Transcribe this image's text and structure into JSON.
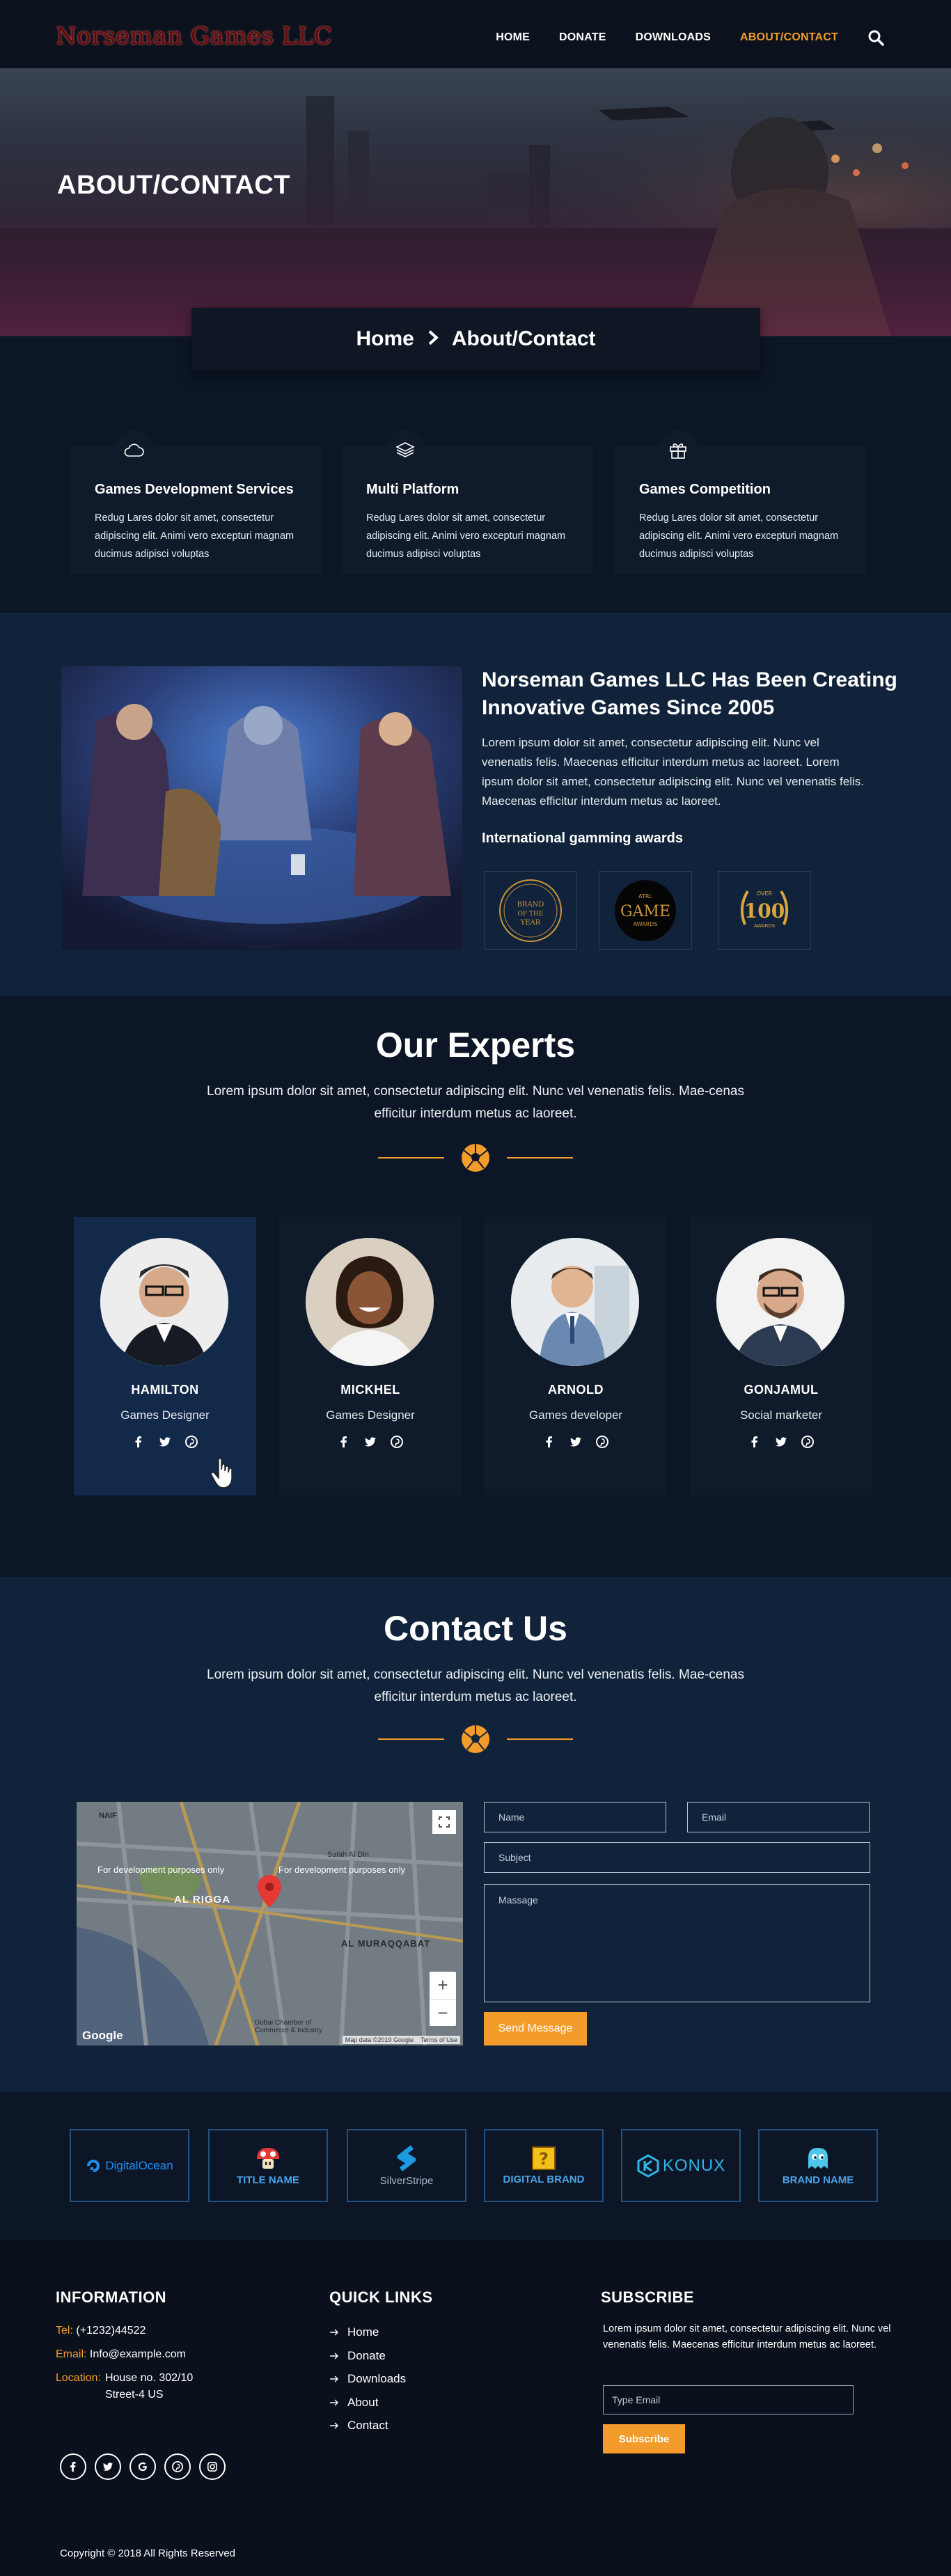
{
  "brand": {
    "logo_text": "Norseman Games LLC"
  },
  "nav": {
    "items": [
      "HOME",
      "DONATE",
      "DOWNLOADS",
      "ABOUT/CONTACT"
    ],
    "active_index": 3,
    "search_icon": "search-icon"
  },
  "hero": {
    "title": "ABOUT/CONTACT"
  },
  "breadcrumb": {
    "home": "Home",
    "current": "About/Contact"
  },
  "services": [
    {
      "icon": "cloud-icon",
      "title": "Games Development Services",
      "text": "Redug Lares dolor sit amet, consectetur adipiscing elit. Animi vero excepturi magnam ducimus adipisci voluptas"
    },
    {
      "icon": "layers-icon",
      "title": "Multi Platform",
      "text": "Redug Lares dolor sit amet, consectetur adipiscing elit. Animi vero excepturi magnam ducimus adipisci voluptas"
    },
    {
      "icon": "gift-icon",
      "title": "Games Competition",
      "text": "Redug Lares dolor sit amet, consectetur adipiscing elit. Animi vero excepturi magnam ducimus adipisci voluptas"
    }
  ],
  "about": {
    "heading": "Norseman Games LLC Has Been Creating Innovative Games Since 2005",
    "text": "Lorem ipsum dolor sit amet, consectetur adipiscing elit. Nunc vel venenatis felis. Maecenas efficitur interdum metus ac laoreet. Lorem ipsum dolor sit amet, consectetur adipiscing elit. Nunc vel venenatis felis. Maecenas efficitur interdum metus ac laoreet.",
    "awards_title": "International gamming awards",
    "awards": [
      {
        "line1": "BRAND",
        "line2": "OF THE",
        "line3": "YEAR"
      },
      {
        "line1": "ATRL",
        "line2": "GAME",
        "line3": "AWARDS"
      },
      {
        "line1": "OVER",
        "line2": "100",
        "line3": "AWARDS"
      }
    ]
  },
  "experts": {
    "title": "Our Experts",
    "text": "Lorem ipsum dolor sit amet, consectetur adipiscing elit. Nunc vel venenatis felis. Mae-cenas efficitur interdum metus ac laoreet.",
    "members": [
      {
        "name": "HAMILTON",
        "role": "Games Designer"
      },
      {
        "name": "MICKHEL",
        "role": "Games Designer"
      },
      {
        "name": "ARNOLD",
        "role": "Games developer"
      },
      {
        "name": "GONJAMUL",
        "role": "Social marketer"
      }
    ]
  },
  "contact": {
    "title": "Contact Us",
    "text": "Lorem ipsum dolor sit amet, consectetur adipiscing elit. Nunc vel venenatis felis. Mae-cenas efficitur interdum metus ac laoreet.",
    "name_placeholder": "Name",
    "email_placeholder": "Email",
    "subject_placeholder": "Subject",
    "message_placeholder": "Massage",
    "send_label": "Send Message",
    "map": {
      "dev_notice": "For development purposes only",
      "labels": [
        "NAIF",
        "AL RIGGA",
        "AL MURAQQABAT",
        "Salah Al Din",
        "Dubai Chamber of Commerce & Industry"
      ],
      "google": "Google",
      "credit": "Map data ©2019 Google",
      "terms": "Terms of Use"
    }
  },
  "brands": [
    {
      "name": "DigitalOcean",
      "icon": "digitalocean-icon",
      "color": "#1f8ef1"
    },
    {
      "name": "TITLE NAME",
      "icon": "mushroom-icon",
      "color": "#e53935"
    },
    {
      "name": "SilverStripe",
      "icon": "silverstripe-icon",
      "color": "#1b9ae0"
    },
    {
      "name": "DIGITAL BRAND",
      "icon": "question-block-icon",
      "color": "#f2c21b"
    },
    {
      "name": "KONUX",
      "icon": "konux-icon",
      "color": "#2fb5e8"
    },
    {
      "name": "BRAND NAME",
      "icon": "ghost-icon",
      "color": "#4ec6e8"
    }
  ],
  "footer": {
    "info_title": "INFORMATION",
    "tel_label": "Tel:",
    "tel": "(+1232)44522",
    "email_label": "Email:",
    "email": "Info@example.com",
    "location_label": "Location:",
    "location_line1": "House no. 302/10",
    "location_line2": "Street-4 US",
    "links_title": "QUICK LINKS",
    "links": [
      "Home",
      "Donate",
      "Downloads",
      "About",
      "Contact"
    ],
    "subscribe_title": "SUBSCRIBE",
    "subscribe_text": "Lorem ipsum dolor sit amet, consectetur adipiscing elit. Nunc vel venenatis felis. Maecenas efficitur interdum metus ac laoreet.",
    "subscribe_placeholder": "Type Email",
    "subscribe_button": "Subscribe",
    "social": [
      "facebook-icon",
      "twitter-icon",
      "google-icon",
      "pinterest-icon",
      "instagram-icon"
    ],
    "copyright": "Copyright © 2018 All Rights Reserved"
  },
  "colors": {
    "accent": "#f39c2b",
    "bg_dark": "#0c1626",
    "bg_section": "#10233a"
  }
}
